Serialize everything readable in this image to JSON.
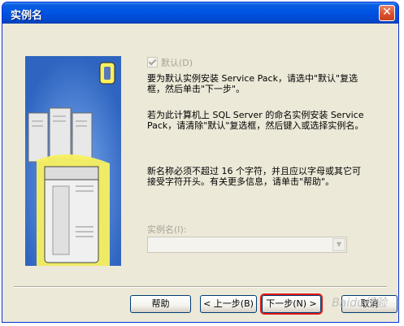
{
  "window": {
    "title": "实例名",
    "close_glyph": "✕"
  },
  "illustration": {
    "icon": "sql-server-computer-illustration",
    "colors": {
      "background": "#4a7fd4",
      "server": "#e8e8e8",
      "highlight": "#f8f060"
    }
  },
  "default_checkbox": {
    "label": "默认(D)",
    "checked": true,
    "enabled": false
  },
  "paragraphs": {
    "p1": "要为默认实例安装 Service Pack，请选中\"默认\"复选框，然后单击\"下一步\"。",
    "p2": "若为此计算机上 SQL Server 的命名实例安装 Service Pack，请清除\"默认\"复选框，然后键入或选择实例名。",
    "p3": "新名称必须不超过 16 个字符，并且应以字母或其它可接受字符开头。有关更多信息，请单击\"帮助\"。"
  },
  "instance": {
    "label": "实例名(I):",
    "value": "",
    "enabled": false
  },
  "buttons": {
    "help": "帮助",
    "back": "< 上一步(B)",
    "next": "下一步(N) >",
    "cancel": "取消"
  },
  "watermark": "Baidu经验",
  "colors": {
    "title_bar": "#0054e3",
    "dialog_face": "#ece9d8",
    "highlight_box": "#e01818"
  }
}
